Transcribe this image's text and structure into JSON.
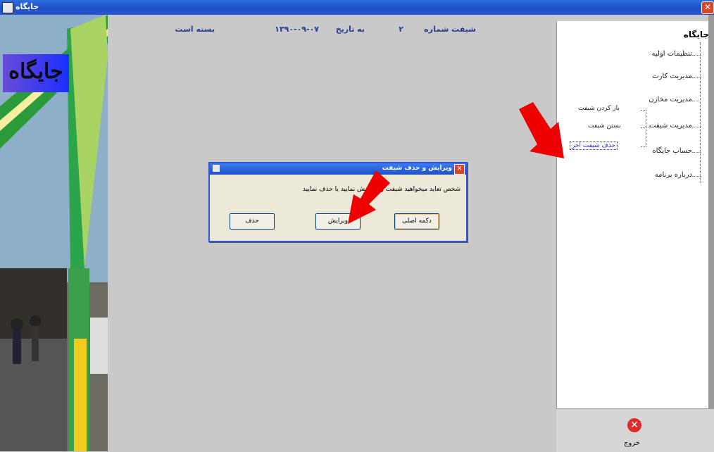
{
  "window": {
    "title": "جایگاه",
    "close_icon": "close-icon"
  },
  "header_info": {
    "shift_label": "شیفت شماره",
    "shift_number": "۲",
    "date_label": "به تاریخ",
    "date_value": "۱۳۹۰-۰۹-۰۷",
    "status_text": "بسته است"
  },
  "photo": {
    "logo_text": "جایگاه"
  },
  "sidebar": {
    "root_label": "جایگاه",
    "items": [
      {
        "label": "تنظیمات اولیه"
      },
      {
        "label": "مدیریت کارت"
      },
      {
        "label": "مدیریت مخازن"
      },
      {
        "label": "مدیریت شیفت"
      },
      {
        "label": "حساب جایگاه"
      },
      {
        "label": "درباره برنامه"
      }
    ],
    "shift_sub_items": [
      {
        "label": "باز کردن شیفت"
      },
      {
        "label": "بستن شیفت"
      },
      {
        "label": "حذف شیفت آخر"
      }
    ]
  },
  "exit": {
    "label": "خروج",
    "icon": "exit-icon"
  },
  "dialog": {
    "title": "ویرایش و حذف شیفت",
    "message": "شخص تعاید میخواهید شیفت را ویرایش نمایید یا حذف نمایید",
    "buttons": {
      "return": "دکمه اصلی",
      "edit": "ویرایش",
      "delete": "حذف"
    }
  },
  "colors": {
    "title_bar": "#2f6fe0",
    "annotation_arrow": "#ee0000"
  }
}
